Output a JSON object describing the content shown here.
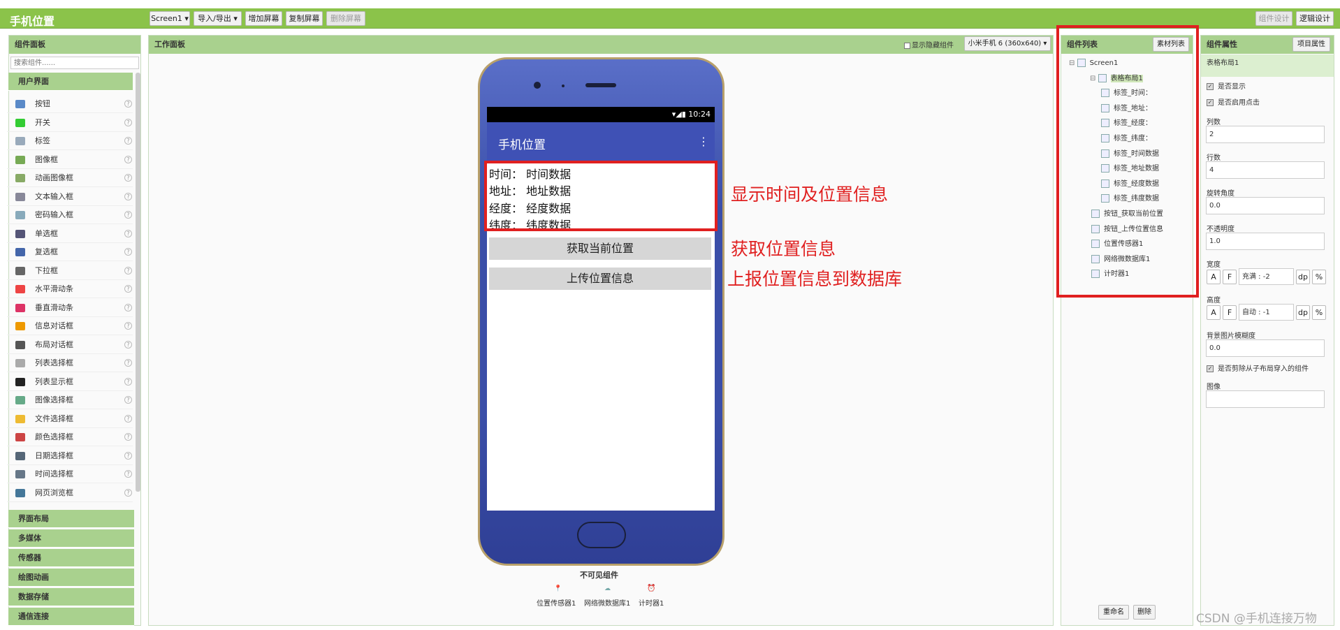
{
  "toolbar": {
    "title": "手机位置",
    "screen": "Screen1 ▾",
    "import_export": "导入/导出 ▾",
    "add_screen": "增加屏幕",
    "copy_screen": "复制屏幕",
    "delete_screen": "删除屏幕",
    "designer": "组件设计",
    "blocks": "逻辑设计"
  },
  "palette": {
    "title": "组件面板",
    "search_placeholder": "搜索组件......",
    "section": "用户界面",
    "items": [
      "按钮",
      "开关",
      "标签",
      "图像框",
      "动画图像框",
      "文本输入框",
      "密码输入框",
      "单选框",
      "复选框",
      "下拉框",
      "水平滑动条",
      "垂直滑动条",
      "信息对话框",
      "布局对话框",
      "列表选择框",
      "列表显示框",
      "图像选择框",
      "文件选择框",
      "颜色选择框",
      "日期选择框",
      "时间选择框",
      "网页浏览框"
    ],
    "categories": [
      "界面布局",
      "多媒体",
      "传感器",
      "绘图动画",
      "数据存储",
      "通信连接"
    ]
  },
  "viewer": {
    "title": "工作面板",
    "show_hidden": "显示隐藏组件",
    "device": "小米手机 6 (360x640) ▾",
    "status_time": "10:24",
    "app_title": "手机位置",
    "rows": [
      "时间： 时间数据",
      "地址： 地址数据",
      "经度： 经度数据",
      "纬度： 纬度数据"
    ],
    "btn_get": "获取当前位置",
    "btn_upload": "上传位置信息",
    "nonvisible_title": "不可见组件",
    "nonvisible": [
      "位置传感器1",
      "网络微数据库1",
      "计时器1"
    ]
  },
  "annotations": [
    "显示时间及位置信息",
    "获取位置信息",
    "上报位置信息到数据库"
  ],
  "components": {
    "title": "组件列表",
    "assets_btn": "素材列表",
    "tree": [
      "Screen1",
      "表格布局1",
      "标签_时间：",
      "标签_地址：",
      "标签_经度：",
      "标签_纬度：",
      "标签_时间数据",
      "标签_地址数据",
      "标签_经度数据",
      "标签_纬度数据",
      "按钮_获取当前位置",
      "按钮_上传位置信息",
      "位置传感器1",
      "网络微数据库1",
      "计时器1"
    ],
    "rename": "重命名",
    "delete": "删除"
  },
  "properties": {
    "title": "组件属性",
    "project_btn": "项目属性",
    "selected": "表格布局1",
    "visible": "是否显示",
    "clickable": "是否启用点击",
    "columns_label": "列数",
    "columns": "2",
    "rows_label": "行数",
    "rows": "4",
    "rotation_label": "旋转角度",
    "rotation": "0.0",
    "opacity_label": "不透明度",
    "opacity": "1.0",
    "width_label": "宽度",
    "width_val": "充满 : -2",
    "height_label": "高度",
    "height_val": "自动 : -1",
    "blur_label": "背景图片模糊度",
    "blur": "0.0",
    "clip": "是否剪除从子布局穿入的组件",
    "image_label": "图像",
    "unit_a": "A",
    "unit_f": "F",
    "unit_dp": "dp",
    "unit_pct": "%"
  },
  "watermark": "CSDN @手机连接万物"
}
